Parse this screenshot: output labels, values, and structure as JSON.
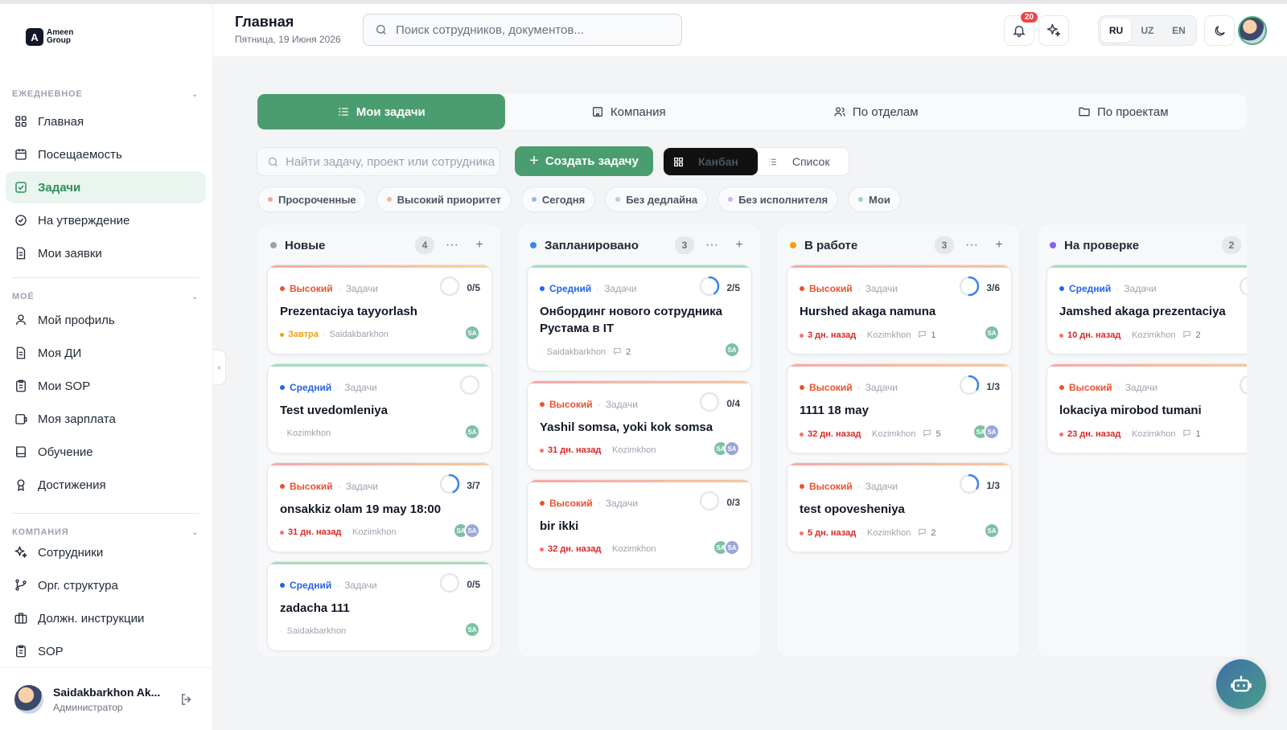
{
  "colors": {
    "accent": "#4a9d6f",
    "high": "#e8532d",
    "medium": "#2563eb",
    "overdue": "#dc2626",
    "soon": "#f59e0b"
  },
  "brand": {
    "logo_line1": "Ameen",
    "logo_line2": "Group"
  },
  "sidebar": {
    "section_daily": "ЕЖЕДНЕВНОЕ",
    "daily_items": [
      {
        "label": "Главная",
        "icon": "grid-icon"
      },
      {
        "label": "Посещаемость",
        "icon": "calendar-icon"
      },
      {
        "label": "Задачи",
        "icon": "checkbox-icon"
      },
      {
        "label": "На утверждение",
        "icon": "check-circle-icon"
      },
      {
        "label": "Мои заявки",
        "icon": "document-icon"
      }
    ],
    "section_mine": "МОЁ",
    "mine_items": [
      {
        "label": "Мой профиль",
        "icon": "user-icon"
      },
      {
        "label": "Моя ДИ",
        "icon": "document-icon"
      },
      {
        "label": "Мои SOP",
        "icon": "clipboard-icon"
      },
      {
        "label": "Моя зарплата",
        "icon": "wallet-icon"
      },
      {
        "label": "Обучение",
        "icon": "book-icon"
      },
      {
        "label": "Достижения",
        "icon": "award-icon"
      }
    ],
    "section_company": "КОМПАНИЯ",
    "company_items": [
      {
        "label": "Сотрудники",
        "icon": "sparkle-icon"
      },
      {
        "label": "Орг. структура",
        "icon": "branch-icon"
      },
      {
        "label": "Должн. инструкции",
        "icon": "briefcase-icon"
      },
      {
        "label": "SOP",
        "icon": "clipboard-icon"
      }
    ],
    "user_name": "Saidakbarkhon Ak...",
    "user_role": "Администратор"
  },
  "header": {
    "title": "Главная",
    "date": "Пятница, 19 Июня 2026",
    "search_placeholder": "Поиск сотрудников, документов...",
    "notifications": "20",
    "languages": [
      "RU",
      "UZ",
      "EN"
    ],
    "active_language": "RU"
  },
  "tabs": [
    "Мои задачи",
    "Компания",
    "По отделам",
    "По проектам"
  ],
  "toolbar": {
    "search_placeholder": "Найти задачу, проект или сотрудника",
    "create_label": "Создать задачу",
    "view_kanban": "Канбан",
    "view_list": "Список"
  },
  "filters": [
    {
      "label": "Просроченные",
      "color": "#f2a2a2"
    },
    {
      "label": "Высокий приоритет",
      "color": "#f6b59a"
    },
    {
      "label": "Сегодня",
      "color": "#93b4f0"
    },
    {
      "label": "Без дедлайна",
      "color": "#c3c7ce"
    },
    {
      "label": "Без исполнителя",
      "color": "#c4b5f3"
    },
    {
      "label": "Мои",
      "color": "#9fd6b6"
    }
  ],
  "columns": [
    {
      "title": "Новые",
      "count": "4",
      "color": "#9ca3af",
      "cards": [
        {
          "priority": "Высокий",
          "category": "Задачи",
          "progress": "0/5",
          "title": "Prezentaciya tayyorlash",
          "due": "Завтра",
          "due_kind": "soon",
          "person": "Saidakbarkhon",
          "comments": "",
          "avatars": [
            "SA"
          ]
        },
        {
          "priority": "Средний",
          "category": "Задачи",
          "progress": "",
          "title": "Test uvedomleniya",
          "due": "",
          "due_kind": "",
          "person": "Kozimkhon",
          "comments": "",
          "avatars": [
            "SA"
          ]
        },
        {
          "priority": "Высокий",
          "category": "Задачи",
          "progress": "3/7",
          "title": "onsakkiz olam 19 may 18:00",
          "due": "31 дн. назад",
          "due_kind": "overdue",
          "person": "Kozimkhon",
          "comments": "",
          "avatars": [
            "SA",
            "SA"
          ]
        },
        {
          "priority": "Средний",
          "category": "Задачи",
          "progress": "0/5",
          "title": "zadacha 111",
          "due": "",
          "due_kind": "",
          "person": "Saidakbarkhon",
          "comments": "",
          "avatars": [
            "SA"
          ]
        }
      ]
    },
    {
      "title": "Запланировано",
      "count": "3",
      "color": "#3b82f6",
      "cards": [
        {
          "priority": "Средний",
          "category": "Задачи",
          "progress": "2/5",
          "title": "Онбординг нового сотрудника Рустама в IT",
          "due": "",
          "due_kind": "",
          "person": "Saidakbarkhon",
          "comments": "2",
          "avatars": [
            "SA"
          ]
        },
        {
          "priority": "Высокий",
          "category": "Задачи",
          "progress": "0/4",
          "title": "Yashil somsa, yoki kok somsa",
          "due": "31 дн. назад",
          "due_kind": "overdue",
          "person": "Kozimkhon",
          "comments": "",
          "avatars": [
            "SA",
            "SA"
          ]
        },
        {
          "priority": "Высокий",
          "category": "Задачи",
          "progress": "0/3",
          "title": "bir ikki",
          "due": "32 дн. назад",
          "due_kind": "overdue",
          "person": "Kozimkhon",
          "comments": "",
          "avatars": [
            "SA",
            "SA"
          ]
        }
      ]
    },
    {
      "title": "В работе",
      "count": "3",
      "color": "#f59e0b",
      "cards": [
        {
          "priority": "Высокий",
          "category": "Задачи",
          "progress": "3/6",
          "title": "Hurshed akaga namuna",
          "due": "3 дн. назад",
          "due_kind": "overdue",
          "person": "Kozimkhon",
          "comments": "1",
          "avatars": [
            "SA"
          ]
        },
        {
          "priority": "Высокий",
          "category": "Задачи",
          "progress": "1/3",
          "title": "1111 18 may",
          "due": "32 дн. назад",
          "due_kind": "overdue",
          "person": "Kozimkhon",
          "comments": "5",
          "avatars": [
            "SA",
            "SA"
          ]
        },
        {
          "priority": "Высокий",
          "category": "Задачи",
          "progress": "1/3",
          "title": "test opovesheniya",
          "due": "5 дн. назад",
          "due_kind": "overdue",
          "person": "Kozimkhon",
          "comments": "2",
          "avatars": [
            "SA"
          ]
        }
      ]
    },
    {
      "title": "На проверке",
      "count": "2",
      "color": "#8b5cf6",
      "cards": [
        {
          "priority": "Средний",
          "category": "Задачи",
          "progress": "",
          "title": "Jamshed akaga prezentaciya",
          "due": "10 дн. назад",
          "due_kind": "overdue",
          "person": "Kozimkhon",
          "comments": "2",
          "avatars": []
        },
        {
          "priority": "Высокий",
          "category": "Задачи",
          "progress": "",
          "title": "lokaciya mirobod tumani",
          "due": "23 дн. назад",
          "due_kind": "overdue",
          "person": "Kozimkhon",
          "comments": "1",
          "avatars": []
        }
      ]
    }
  ]
}
